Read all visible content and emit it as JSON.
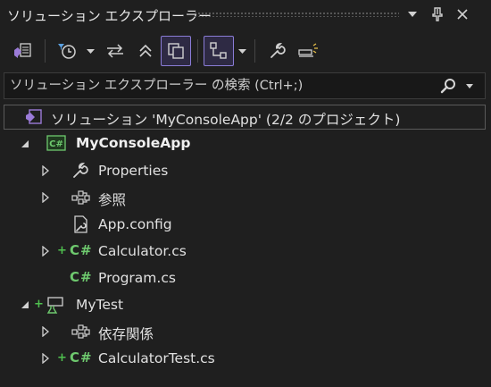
{
  "window": {
    "title": "ソリューション エクスプローラー"
  },
  "search": {
    "placeholder": "ソリューション エクスプローラー の検索 (Ctrl+;)"
  },
  "tree": {
    "solution": "ソリューション 'MyConsoleApp' (2/2 のプロジェクト)",
    "project1": "MyConsoleApp",
    "properties": "Properties",
    "references": "参照",
    "appconfig": "App.config",
    "calculator": "Calculator.cs",
    "program": "Program.cs",
    "project2": "MyTest",
    "dependencies": "依存関係",
    "calculatortest": "CalculatorTest.cs"
  },
  "icons": {
    "cs_glyph": "C#"
  },
  "colors": {
    "background": "#1f1f1f",
    "accent": "#8a7cd6",
    "csharp_green": "#6ec96e",
    "vs_purple": "#9b7bd8"
  }
}
